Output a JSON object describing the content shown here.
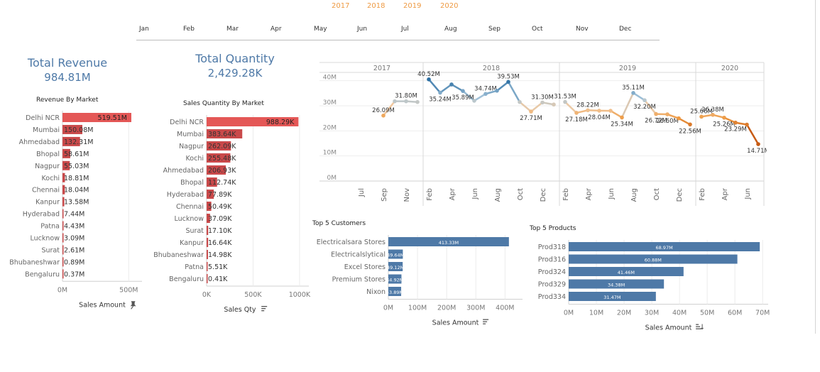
{
  "filters": {
    "years": [
      "2017",
      "2018",
      "2019",
      "2020"
    ],
    "months": [
      "Jan",
      "Feb",
      "Mar",
      "Apr",
      "May",
      "Jun",
      "Jul",
      "Aug",
      "Sep",
      "Oct",
      "Nov",
      "Dec"
    ]
  },
  "kpis": {
    "revenue": {
      "title": "Total Revenue",
      "value": "984.81M"
    },
    "quantity": {
      "title": "Total Quantity",
      "value": "2,429.28K"
    }
  },
  "colors": {
    "highlight": "#e45756",
    "blue": "#4e79a7",
    "orange": "#ee9a43",
    "grid": "#e6e6e6"
  },
  "chart_data": [
    {
      "id": "revenue_by_market",
      "type": "bar",
      "title": "Revenue By Market",
      "xlabel": "Sales Amount",
      "header_icon": "pin-icon",
      "categories": [
        "Delhi NCR",
        "Mumbai",
        "Ahmedabad",
        "Bhopal",
        "Nagpur",
        "Kochi",
        "Chennai",
        "Kanpur",
        "Hyderabad",
        "Patna",
        "Lucknow",
        "Surat",
        "Bhubaneshwar",
        "Bengaluru"
      ],
      "values": [
        519.51,
        150.08,
        132.31,
        58.61,
        55.03,
        18.81,
        18.04,
        13.58,
        7.44,
        4.43,
        3.09,
        2.61,
        0.89,
        0.37
      ],
      "labels": [
        "519.51M",
        "150.08M",
        "132.31M",
        "58.61M",
        "55.03M",
        "18.81M",
        "18.04M",
        "13.58M",
        "7.44M",
        "4.43M",
        "3.09M",
        "2.61M",
        "0.89M",
        "0.37M"
      ],
      "xlim": [
        0,
        600
      ],
      "xticks": [
        "0M",
        "500M"
      ],
      "xtick_values": [
        0,
        500
      ],
      "color": "#e45756"
    },
    {
      "id": "sales_qty_by_market",
      "type": "bar",
      "title": "Sales Quantity By Market",
      "xlabel": "Sales Qty",
      "header_icon": "sort-icon",
      "categories": [
        "Delhi NCR",
        "Mumbai",
        "Nagpur",
        "Kochi",
        "Ahmedabad",
        "Bhopal",
        "Hyderabad",
        "Chennai",
        "Lucknow",
        "Surat",
        "Kanpur",
        "Bhubaneshwar",
        "Patna",
        "Bengaluru"
      ],
      "values": [
        988.29,
        383.64,
        262.09,
        255.48,
        206.93,
        112.74,
        77.89,
        50.49,
        37.09,
        17.1,
        16.64,
        14.98,
        5.51,
        0.41
      ],
      "labels": [
        "988.29K",
        "383.64K",
        "262.09K",
        "255.48K",
        "206.93K",
        "112.74K",
        "77.89K",
        "50.49K",
        "37.09K",
        "17.10K",
        "16.64K",
        "14.98K",
        "5.51K",
        "0.41K"
      ],
      "xlim": [
        0,
        1100
      ],
      "xticks": [
        "0K",
        "500K",
        "1000K"
      ],
      "xtick_values": [
        0,
        500,
        1000
      ],
      "color": "#e45756"
    },
    {
      "id": "monthly_revenue_trend",
      "type": "line",
      "years": [
        "2017",
        "2018",
        "2019",
        "2020"
      ],
      "ylim": [
        0,
        45
      ],
      "yticks": [
        "0M",
        "10M",
        "20M",
        "30M",
        "40M"
      ],
      "ytick_values": [
        0,
        10,
        20,
        30,
        40
      ],
      "xtick_labels": [
        "Jul",
        "Sep",
        "Nov",
        "Feb",
        "Apr",
        "Jun",
        "Aug",
        "Oct",
        "Dec",
        "Feb",
        "Apr",
        "Jun",
        "Aug",
        "Oct",
        "Dec",
        "Feb",
        "Apr",
        "Jun"
      ],
      "xtick_months": [
        1,
        3,
        5,
        7,
        9,
        11,
        13,
        15,
        17,
        19,
        21,
        23,
        25,
        27,
        29,
        31,
        33,
        35
      ],
      "color_scale": [
        "#ee9a43",
        "#f1c9a0",
        "#a8c6db",
        "#2c6fa3"
      ],
      "color_scale_ext": [
        "#c75b14",
        "#ee9a43"
      ],
      "months": [
        "2017-06",
        "2017-07",
        "2017-08",
        "2017-09",
        "2017-10",
        "2017-11",
        "2017-12",
        "2018-01",
        "2018-02",
        "2018-03",
        "2018-04",
        "2018-05",
        "2018-06",
        "2018-07",
        "2018-08",
        "2018-09",
        "2018-10",
        "2018-11",
        "2018-12",
        "2019-01",
        "2019-02",
        "2019-03",
        "2019-04",
        "2019-05",
        "2019-06",
        "2019-07",
        "2019-08",
        "2019-09",
        "2019-10",
        "2019-11",
        "2019-12",
        "2020-01",
        "2020-02",
        "2020-03",
        "2020-04",
        "2020-05",
        "2020-06"
      ],
      "values": [
        null,
        null,
        null,
        26.09,
        31.8,
        31.8,
        31.5,
        40.52,
        35.24,
        38.5,
        35.89,
        32.0,
        34.74,
        36.0,
        39.53,
        31.5,
        27.71,
        31.3,
        30.5,
        31.53,
        27.18,
        28.22,
        28.04,
        28.0,
        25.34,
        35.11,
        32.2,
        26.72,
        26.6,
        25.0,
        22.56,
        25.66,
        26.38,
        25.26,
        23.29,
        22.5,
        14.71
      ],
      "labels": [
        null,
        null,
        null,
        "26.09M",
        null,
        "31.80M",
        null,
        "40.52M",
        "35.24M",
        null,
        "35.89M",
        null,
        "34.74M",
        null,
        "39.53M",
        null,
        "27.71M",
        "31.30M",
        null,
        "31.53M",
        "27.18M",
        "28.22M",
        "28.04M",
        null,
        "25.34M",
        "35.11M",
        "32.20M",
        "26.72M",
        "26.60M",
        null,
        "22.56M",
        "25.66M",
        "26.38M",
        "25.26M",
        "23.29M",
        null,
        "14.71M"
      ]
    },
    {
      "id": "top5_customers",
      "type": "bar",
      "title": "Top 5 Customers",
      "xlabel": "Sales Amount",
      "header_icon": "sort-icon",
      "categories": [
        "Electricalsara Stores",
        "Electricalslytical",
        "Excel Stores",
        "Premium Stores",
        "Nixon"
      ],
      "values": [
        413.33,
        49.64,
        49.12,
        44.92,
        43.89
      ],
      "labels": [
        "413.33M",
        "49.64M",
        "49.12M",
        "44.92M",
        "43.89M"
      ],
      "xlim": [
        0,
        460
      ],
      "xticks": [
        "0M",
        "100M",
        "200M",
        "300M",
        "400M"
      ],
      "xtick_values": [
        0,
        100,
        200,
        300,
        400
      ],
      "color": "#4e79a7"
    },
    {
      "id": "top5_products",
      "type": "bar",
      "title": "Top 5 Products",
      "xlabel": "Sales Amount",
      "header_icon": "sort-desc-icon",
      "categories": [
        "Prod318",
        "Prod316",
        "Prod324",
        "Prod329",
        "Prod334"
      ],
      "values": [
        68.97,
        60.88,
        41.46,
        34.38,
        31.47
      ],
      "labels": [
        "68.97M",
        "60.88M",
        "41.46M",
        "34.38M",
        "31.47M"
      ],
      "xlim": [
        0,
        72
      ],
      "xticks": [
        "0M",
        "10M",
        "20M",
        "30M",
        "40M",
        "50M",
        "60M",
        "70M"
      ],
      "xtick_values": [
        0,
        10,
        20,
        30,
        40,
        50,
        60,
        70
      ],
      "color": "#4e79a7"
    }
  ]
}
